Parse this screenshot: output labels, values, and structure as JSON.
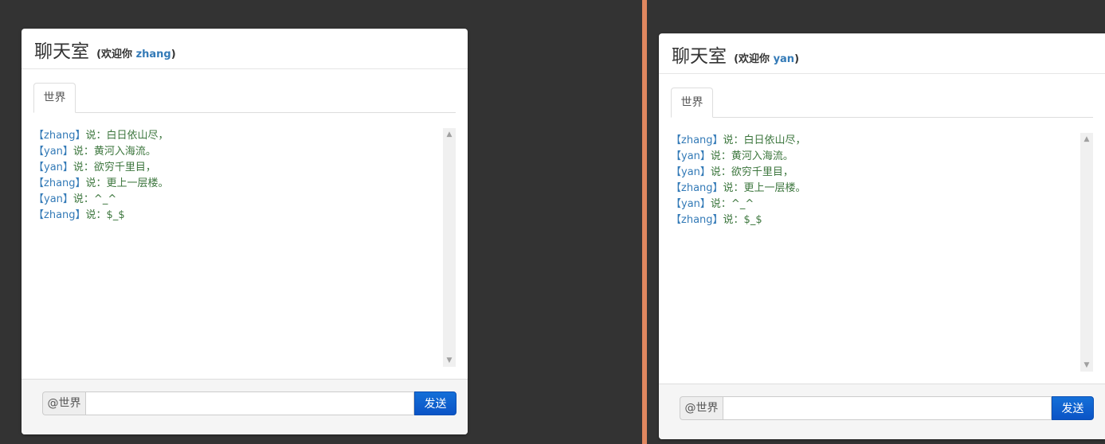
{
  "left": {
    "title": "聊天室",
    "welcome_open": "(欢迎你 ",
    "username": "zhang",
    "welcome_close": ")",
    "tab_label": "世界",
    "messages": [
      {
        "who": "【zhang】",
        "said": "说：",
        "text": "白日依山尽，"
      },
      {
        "who": "【yan】",
        "said": "说：",
        "text": "黄河入海流。"
      },
      {
        "who": "【yan】",
        "said": "说：",
        "text": "欲穷千里目，"
      },
      {
        "who": "【zhang】",
        "said": "说：",
        "text": "更上一层楼。"
      },
      {
        "who": "【yan】",
        "said": "说：",
        "text": "^_^"
      },
      {
        "who": "【zhang】",
        "said": "说：",
        "text": "$_$"
      }
    ],
    "addon": "@世界",
    "input_value": "",
    "send_label": "发送"
  },
  "right": {
    "title": "聊天室",
    "welcome_open": "(欢迎你 ",
    "username": "yan",
    "welcome_close": ")",
    "tab_label": "世界",
    "messages": [
      {
        "who": "【zhang】",
        "said": "说：",
        "text": "白日依山尽，"
      },
      {
        "who": "【yan】",
        "said": "说：",
        "text": "黄河入海流。"
      },
      {
        "who": "【yan】",
        "said": "说：",
        "text": "欲穷千里目，"
      },
      {
        "who": "【zhang】",
        "said": "说：",
        "text": "更上一层楼。"
      },
      {
        "who": "【yan】",
        "said": "说：",
        "text": "^_^"
      },
      {
        "who": "【zhang】",
        "said": "说：",
        "text": "$_$"
      }
    ],
    "addon": "@世界",
    "input_value": "",
    "send_label": "发送"
  },
  "icons": {
    "scroll_up": "scroll-up-arrow-icon",
    "scroll_down": "scroll-down-arrow-icon"
  },
  "colors": {
    "background": "#333333",
    "divider": "#e0875f",
    "username": "#337ab7",
    "message_text": "#3c763d",
    "send_button": "#0b54c6"
  }
}
